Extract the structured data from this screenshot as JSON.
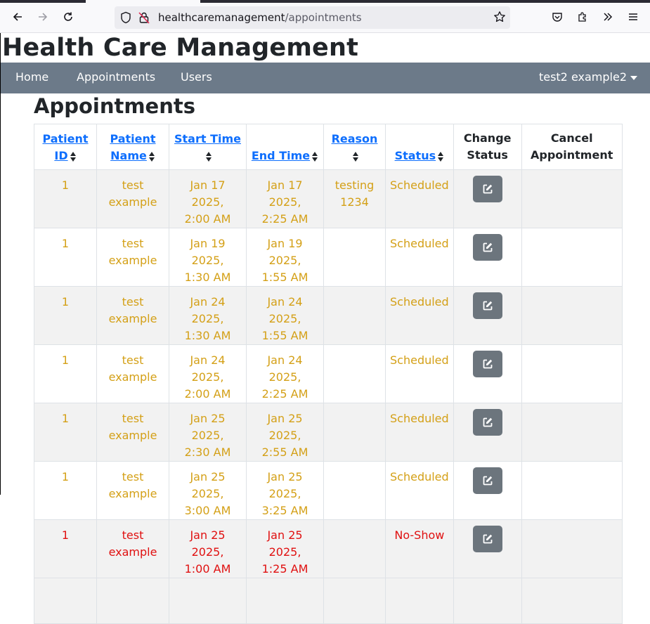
{
  "browser": {
    "url_host": "healthcaremanagement",
    "url_path": "/appointments"
  },
  "site": {
    "title": "Health Care Management"
  },
  "navbar": {
    "links": [
      "Home",
      "Appointments",
      "Users"
    ],
    "user": "test2 example2"
  },
  "section": {
    "title": "Appointments"
  },
  "table": {
    "headers": {
      "patient_id_1": "Patient",
      "patient_id_2": "ID",
      "patient_name_1": "Patient",
      "patient_name_2": "Name",
      "start_time": "Start Time",
      "end_time": "End Time",
      "reason": "Reason",
      "status": "Status",
      "change_status_1": "Change",
      "change_status_2": "Status",
      "cancel_1": "Cancel",
      "cancel_2": "Appointment"
    },
    "rows": [
      {
        "id": "1",
        "name1": "test",
        "name2": "example",
        "start1": "Jan 17 2025,",
        "start2": "2:00 AM",
        "end1": "Jan 17 2025,",
        "end2": "2:25 AM",
        "reason1": "testing",
        "reason2": "1234",
        "status": "Scheduled"
      },
      {
        "id": "1",
        "name1": "test",
        "name2": "example",
        "start1": "Jan 19 2025,",
        "start2": "1:30 AM",
        "end1": "Jan 19 2025,",
        "end2": "1:55 AM",
        "reason1": "",
        "reason2": "",
        "status": "Scheduled"
      },
      {
        "id": "1",
        "name1": "test",
        "name2": "example",
        "start1": "Jan 24 2025,",
        "start2": "1:30 AM",
        "end1": "Jan 24 2025,",
        "end2": "1:55 AM",
        "reason1": "",
        "reason2": "",
        "status": "Scheduled"
      },
      {
        "id": "1",
        "name1": "test",
        "name2": "example",
        "start1": "Jan 24 2025,",
        "start2": "2:00 AM",
        "end1": "Jan 24 2025,",
        "end2": "2:25 AM",
        "reason1": "",
        "reason2": "",
        "status": "Scheduled"
      },
      {
        "id": "1",
        "name1": "test",
        "name2": "example",
        "start1": "Jan 25 2025,",
        "start2": "2:30 AM",
        "end1": "Jan 25 2025,",
        "end2": "2:55 AM",
        "reason1": "",
        "reason2": "",
        "status": "Scheduled"
      },
      {
        "id": "1",
        "name1": "test",
        "name2": "example",
        "start1": "Jan 25 2025,",
        "start2": "3:00 AM",
        "end1": "Jan 25 2025,",
        "end2": "3:25 AM",
        "reason1": "",
        "reason2": "",
        "status": "Scheduled"
      },
      {
        "id": "1",
        "name1": "test",
        "name2": "example",
        "start1": "Jan 25 2025,",
        "start2": "1:00 AM",
        "end1": "Jan 25 2025,",
        "end2": "1:25 AM",
        "reason1": "",
        "reason2": "",
        "status": "No-Show"
      }
    ]
  },
  "colors": {
    "navbar": "#6c7a89",
    "scheduled_text": "#d4a017",
    "noshow_text": "#e01010",
    "edit_button": "#6c757d",
    "link": "#0d6efd"
  }
}
